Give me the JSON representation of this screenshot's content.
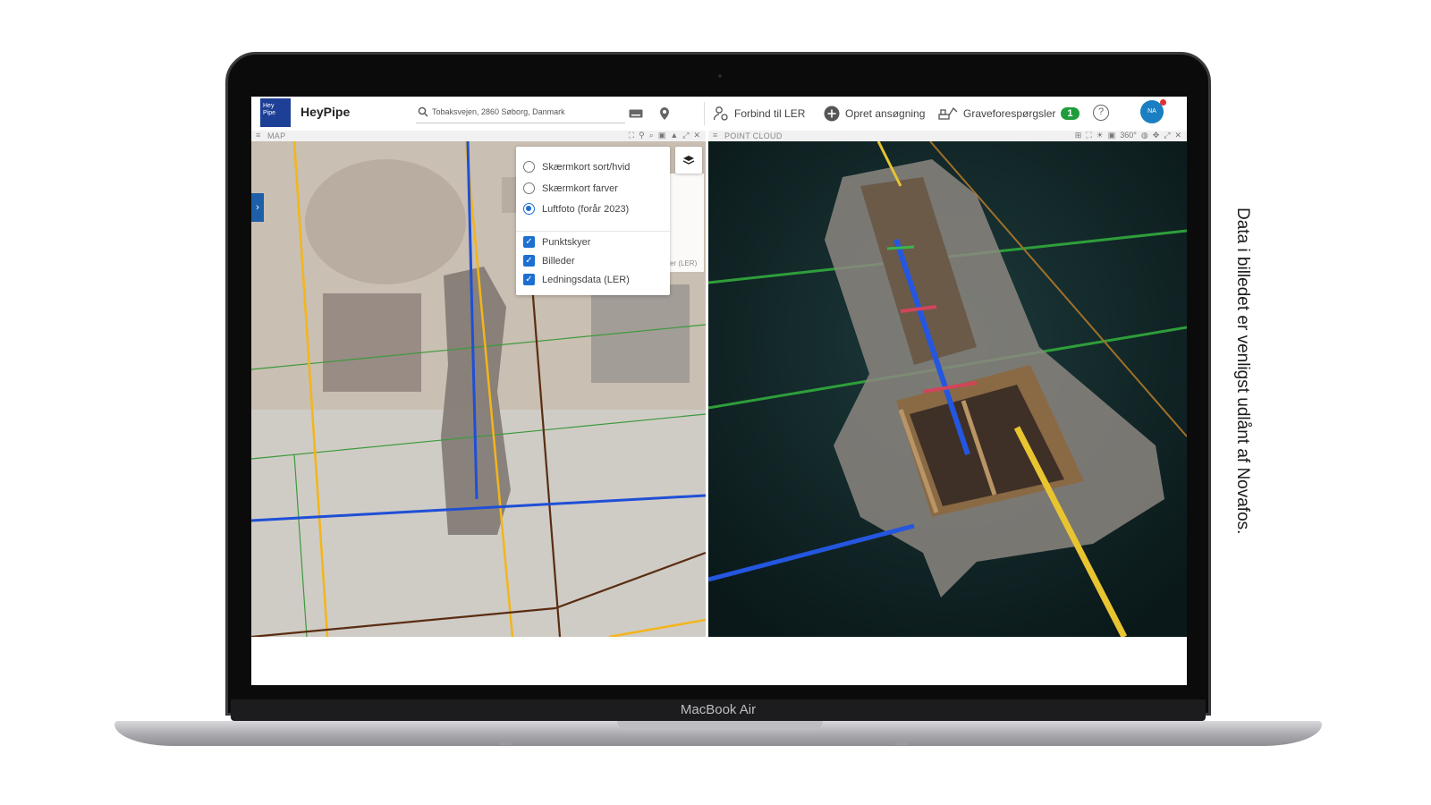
{
  "device": {
    "brand_label": "MacBook Air"
  },
  "side_caption": "Data i billedet er venligst udlånt af Novafos.",
  "app": {
    "logo_text": "Hey Pipe",
    "name": "HeyPipe",
    "search": {
      "value": "Tobaksvejen, 2860 Søborg, Danmark"
    },
    "actions": {
      "connect_label": "Forbind til LER",
      "create_label": "Opret ansøgning",
      "requests_label": "Graveforespørgsler",
      "requests_count": "1"
    },
    "help_label": "?",
    "avatar_initials": "NA"
  },
  "map_pane": {
    "title": "MAP",
    "layers": {
      "base_options": [
        {
          "label": "Skærmkort sort/hvid",
          "selected": false
        },
        {
          "label": "Skærmkort farver",
          "selected": false
        },
        {
          "label": "Luftfoto (forår 2023)",
          "selected": true
        }
      ],
      "overlay_options": [
        {
          "label": "Punktskyer",
          "checked": true
        },
        {
          "label": "Billeder",
          "checked": true
        },
        {
          "label": "Ledningsdata (LER)",
          "checked": true
        }
      ],
      "ghost_text": "er (LER)"
    }
  },
  "pointcloud_pane": {
    "title": "POINT CLOUD",
    "tool_360": "360°"
  },
  "colors": {
    "brand_blue": "#1d3f95",
    "accent_blue": "#1d6fd1",
    "badge_green": "#1f9d3c",
    "pipe_blue": "#1e4fd6",
    "pipe_yellow": "#f3b51a",
    "pipe_brown": "#5a2d12",
    "pipe_green": "#3c9a3c"
  }
}
